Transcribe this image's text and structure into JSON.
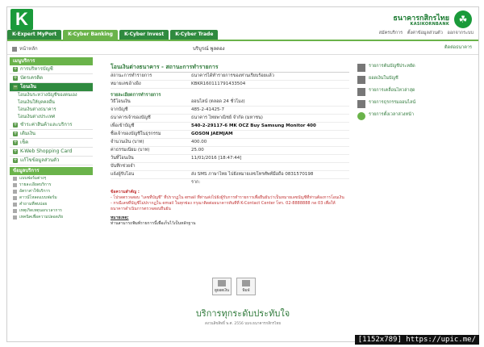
{
  "header": {
    "logo_letter": "K",
    "logo_sub": "KASIKORNTHAI",
    "bank_name_th": "ธนาคารกสิกรไทย",
    "bank_name_en": "KASIKORNBANK",
    "tabs": [
      {
        "label": "K-Expert MyPort"
      },
      {
        "label": "K-Cyber Banking"
      },
      {
        "label": "K-Cyber Invest"
      },
      {
        "label": "K-Cyber Trade"
      }
    ],
    "top_links": [
      "สมัครบริการ",
      "ตั้งค่าข้อมูลส่วนตัว",
      "ออกจากระบบ"
    ]
  },
  "navbar": {
    "home_label": "หน้าหลัก",
    "greeting": "บริบูรณ์ พูลตอง",
    "logout_label": "ติดต่อธนาคาร"
  },
  "sidebar": {
    "header": "เมนูบริการ",
    "items": [
      {
        "label": "การบริหารบัญชี"
      },
      {
        "label": "บัตรเครดิต"
      },
      {
        "label": "โอนเงิน"
      }
    ],
    "sub_items": [
      {
        "label": "โอนเงินระหว่างบัญชีของตนเอง"
      },
      {
        "label": "โอนเงินให้บุคคลอื่น"
      },
      {
        "label": "โอนเงินต่างธนาคาร"
      },
      {
        "label": "โอนเงินต่างประเทศ"
      }
    ],
    "items2": [
      {
        "label": "ชำระค่าสินค้าและบริการ"
      },
      {
        "label": "เติมเงิน"
      },
      {
        "label": "เช็ค"
      },
      {
        "label": "K-Web Shopping Card"
      },
      {
        "label": "แก้ไขข้อมูลส่วนตัว"
      }
    ],
    "header2": "ข้อมูลบริการ",
    "info_items": [
      {
        "label": "แบบฟอร์มต่างๆ"
      },
      {
        "label": "รายละเอียดบริการ"
      },
      {
        "label": "อัตราค่าใช้บริการ"
      },
      {
        "label": "ดาวน์โหลดแบบฟอร์ม"
      },
      {
        "label": "คำถามที่พบบ่อย"
      },
      {
        "label": "เหตุเกิดเหตุนอกเวลาการ"
      },
      {
        "label": "เทคนิคเพื่อความปลอดภัย"
      }
    ]
  },
  "main": {
    "title": "โอนเงินต่างธนาคาร - สถานะการทำรายการ",
    "rows_top": [
      {
        "label": "สถานะการทำรายการ",
        "value": "ธนาคารได้ทำรายการของท่านเรียบร้อยแล้ว"
      },
      {
        "label": "หมายเลขอ้างอิง",
        "value": "KBKR160111791433504"
      }
    ],
    "section_label": "รายละเอียดการทำรายการ",
    "rows": [
      {
        "label": "วิธีโอนเงิน",
        "value": "ออนไลน์ (ตลอด 24 ชั่วโมง)",
        "bold": false
      },
      {
        "label": "จากบัญชี",
        "value": "485-2-41425-7",
        "bold": false
      },
      {
        "label": "ธนาคารเจ้าของบัญชี",
        "value": "ธนาคาร ไทยพาณิชย์ จำกัด (มหาชน)",
        "bold": false
      },
      {
        "label": "เพื่อเข้าบัญชี",
        "value": "540-2-29117-6 MK OCZ Buy Samsung Monitor 400",
        "bold": true
      },
      {
        "label": "ชื่อเจ้าของบัญชีในธุรกรรม",
        "value": "GOSON JAEMJAM",
        "bold": true
      },
      {
        "label": "จำนวนเงิน (บาท)",
        "value": "400.00",
        "bold": false
      },
      {
        "label": "ค่าธรรมเนียม (บาท)",
        "value": "25.00",
        "bold": false
      },
      {
        "label": "วันที่โอนเงิน",
        "value": "11/01/2016 [18:47:44]",
        "bold": false
      },
      {
        "label": "บันทึกช่วยจำ",
        "value": "",
        "bold": false
      },
      {
        "label": "แจ้งผู้รับโอน",
        "value": "ส่ง SMS ภาษาไทย ไปยังหมายเลขโทรศัพท์มือถือ 0831570198",
        "bold": false
      }
    ],
    "extra_line": "ราก:",
    "notes_title": "ข้อความสำคัญ :",
    "notes": [
      "- โปรดตรวจสอบ \"เลขที่บัญชี\" ที่ปรากฏใน email ที่ท่านส่งไปยังผู้รับการทำรายการเพื่อยืนยันว่าเป็นหมายเลขบัญชีที่ท่านต้องการโอนเงิน",
      "- กรณีเลขที่บัญชีไม่ปรากฏใน email ในทุกช่อง กรุณาติดต่อธนาคารทันทีที่ K-Contact Center โทร. 02-8888888 กด 03 เพื่อให้ธนาคารดำเนินการตรวจสอบยืนยัน"
    ],
    "remark_title": "หมายเหตุ:",
    "remark": "ท่านสามารถพิมพ์รายการนี้เพื่อเก็บไว้เป็นหลักฐาน",
    "buttons": [
      {
        "label": "ดูยอดเงิน"
      },
      {
        "label": "พิมพ์"
      }
    ]
  },
  "right": {
    "items": [
      {
        "label": "รายการต้นบัญชีประหยัด"
      },
      {
        "label": "ยอดเงินในบัญชี"
      },
      {
        "label": "รายการเคลื่อนไหวล่าสุด"
      },
      {
        "label": "รายการธุรกรรมออนไลน์"
      },
      {
        "label": "รายการตั้งเวลาล่วงหน้า"
      }
    ]
  },
  "footer": {
    "slogan": "บริการทุกระดับประทับใจ",
    "copyright": "สงวนลิขสิทธิ์ พ.ศ. 2556 บมจ.ธนาคารกสิกรไทย"
  },
  "watermark": "[1152x789] https://upic.me/"
}
